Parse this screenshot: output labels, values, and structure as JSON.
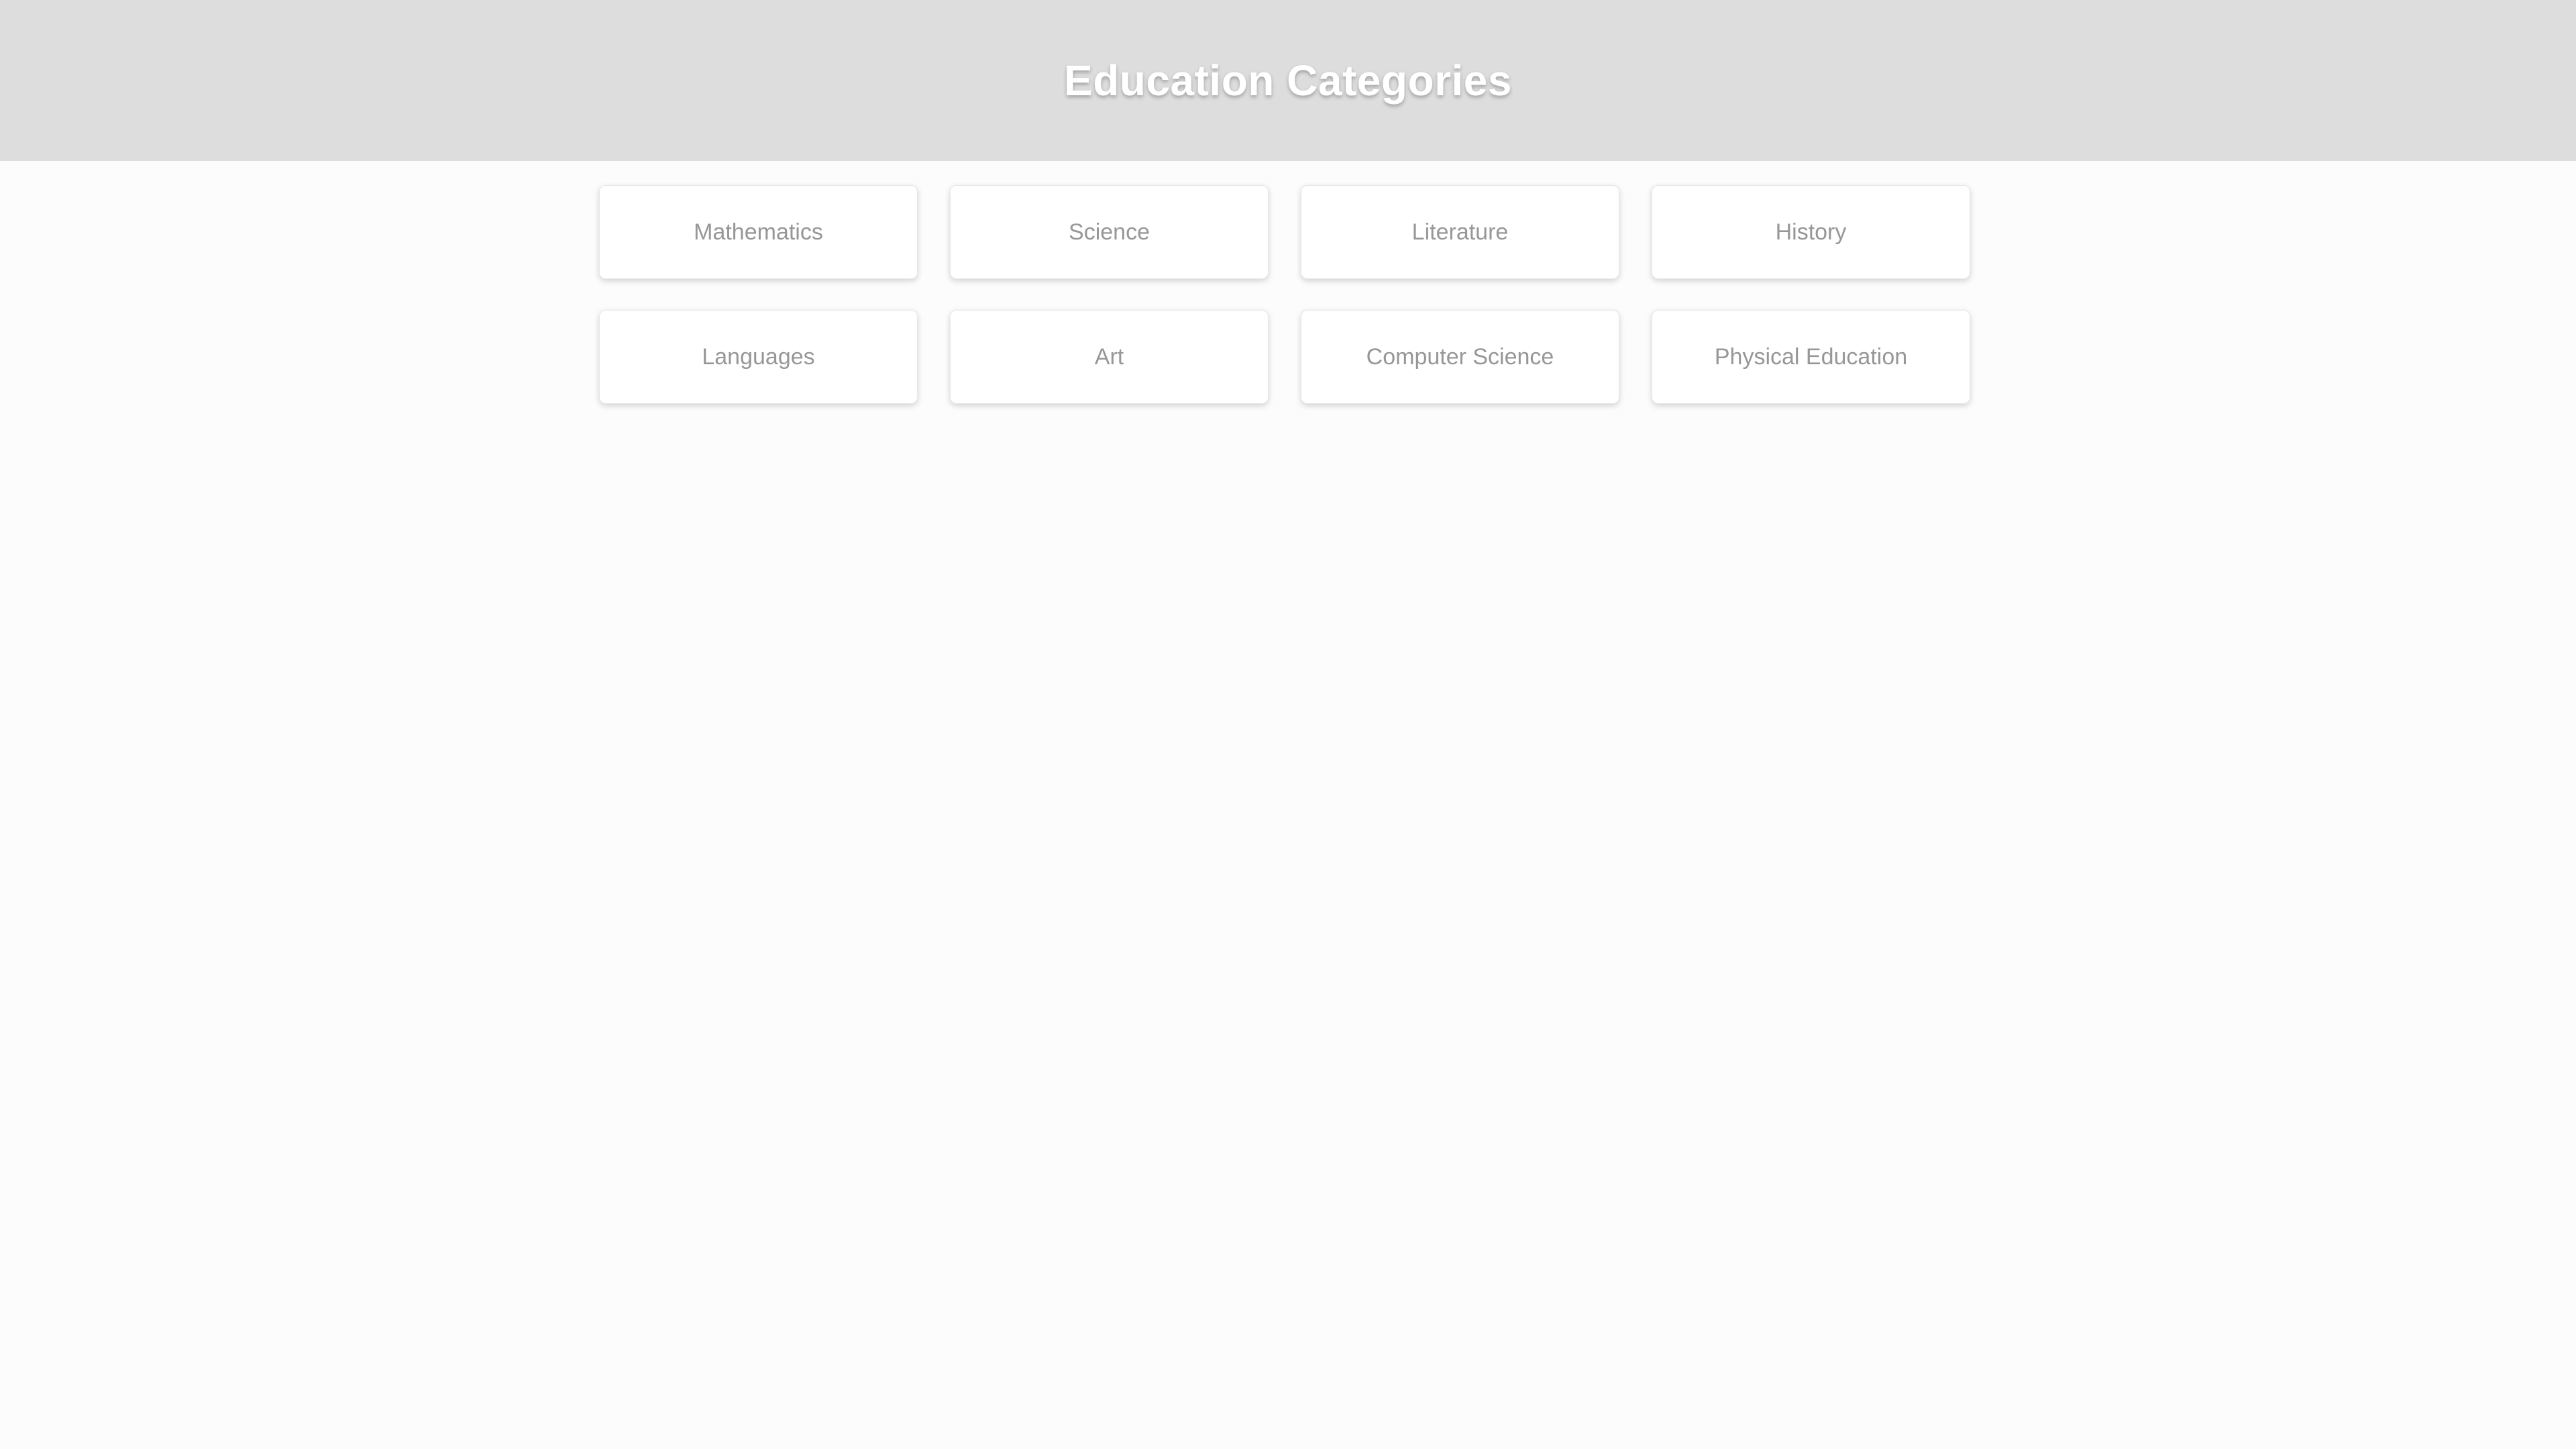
{
  "header": {
    "title": "Education Categories"
  },
  "categories": [
    {
      "label": "Mathematics"
    },
    {
      "label": "Science"
    },
    {
      "label": "Literature"
    },
    {
      "label": "History"
    },
    {
      "label": "Languages"
    },
    {
      "label": "Art"
    },
    {
      "label": "Computer Science"
    },
    {
      "label": "Physical Education"
    }
  ],
  "colors": {
    "header_background": "#dddddd",
    "title_text": "#ffffff",
    "page_background": "#fcfcfc",
    "card_background": "#ffffff",
    "card_text": "#979797"
  }
}
